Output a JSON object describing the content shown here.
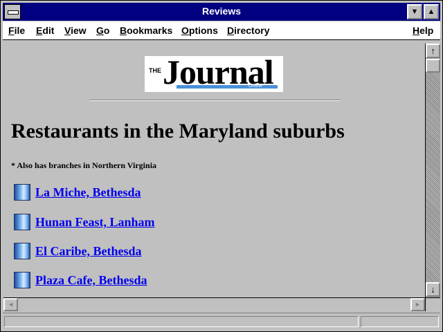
{
  "window": {
    "title": "Reviews"
  },
  "menu": {
    "items": [
      "File",
      "Edit",
      "View",
      "Go",
      "Bookmarks",
      "Options",
      "Directory"
    ],
    "help": "Help"
  },
  "logo": {
    "the": "THE",
    "name": "Journal",
    "tagline": "Online"
  },
  "page": {
    "heading": "Restaurants in the Maryland suburbs",
    "note": "* Also has branches in Northern Virginia",
    "restaurants": [
      {
        "name": "La Miche, Bethesda"
      },
      {
        "name": "Hunan Feast, Lanham"
      },
      {
        "name": "El Caribe, Bethesda"
      },
      {
        "name": "Plaza Cafe, Bethesda"
      }
    ]
  },
  "icons": {
    "scroll_up": "up-arrow-icon",
    "scroll_down": "down-arrow-icon",
    "scroll_left": "left-arrow-icon",
    "scroll_right": "right-arrow-icon",
    "restaurant_bullet": "book-icon"
  },
  "colors": {
    "titlebar": "#000080",
    "link": "#0000ee",
    "background": "#c0c0c0"
  }
}
